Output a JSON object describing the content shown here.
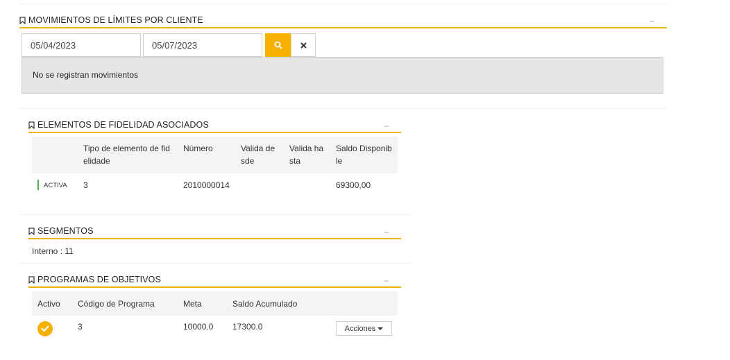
{
  "movimientos": {
    "title": "MOVIMIENTOS DE LÍMITES POR CLIENTE",
    "date_from": "05/04/2023",
    "date_to": "05/07/2023",
    "empty_message": "No se registran movimientos"
  },
  "fidelidad": {
    "title": "ELEMENTOS DE FIDELIDAD ASOCIADOS",
    "columns": [
      "",
      "Tipo de elemento de fid elidade",
      "Número",
      "Valida de sde",
      "Valida ha sta",
      "Saldo Disponib le"
    ],
    "rows": [
      {
        "status": "ACTIVA",
        "tipo": "3",
        "numero": "2010000014",
        "desde": "",
        "hasta": "",
        "saldo": "69300,00"
      }
    ]
  },
  "segmentos": {
    "title": "SEGMENTOS",
    "value": "Interno : 11"
  },
  "programas": {
    "title": "PROGRAMAS DE OBJETIVOS",
    "columns": [
      "Activo",
      "Código de Programa",
      "Meta",
      "Saldo Acumulado",
      ""
    ],
    "rows": [
      {
        "activo": true,
        "codigo": "3",
        "meta": "10000.0",
        "saldo": "17300.0",
        "action_label": "Acciones"
      }
    ]
  },
  "icons": {
    "bookmark": "bookmark-icon",
    "search": "search-icon",
    "clear": "close-icon",
    "check": "check-circle-icon",
    "caret": "caret-down-icon"
  },
  "colors": {
    "accent": "#f5b000",
    "active_status": "#4caf50",
    "empty_bg": "#e6e6e6"
  }
}
